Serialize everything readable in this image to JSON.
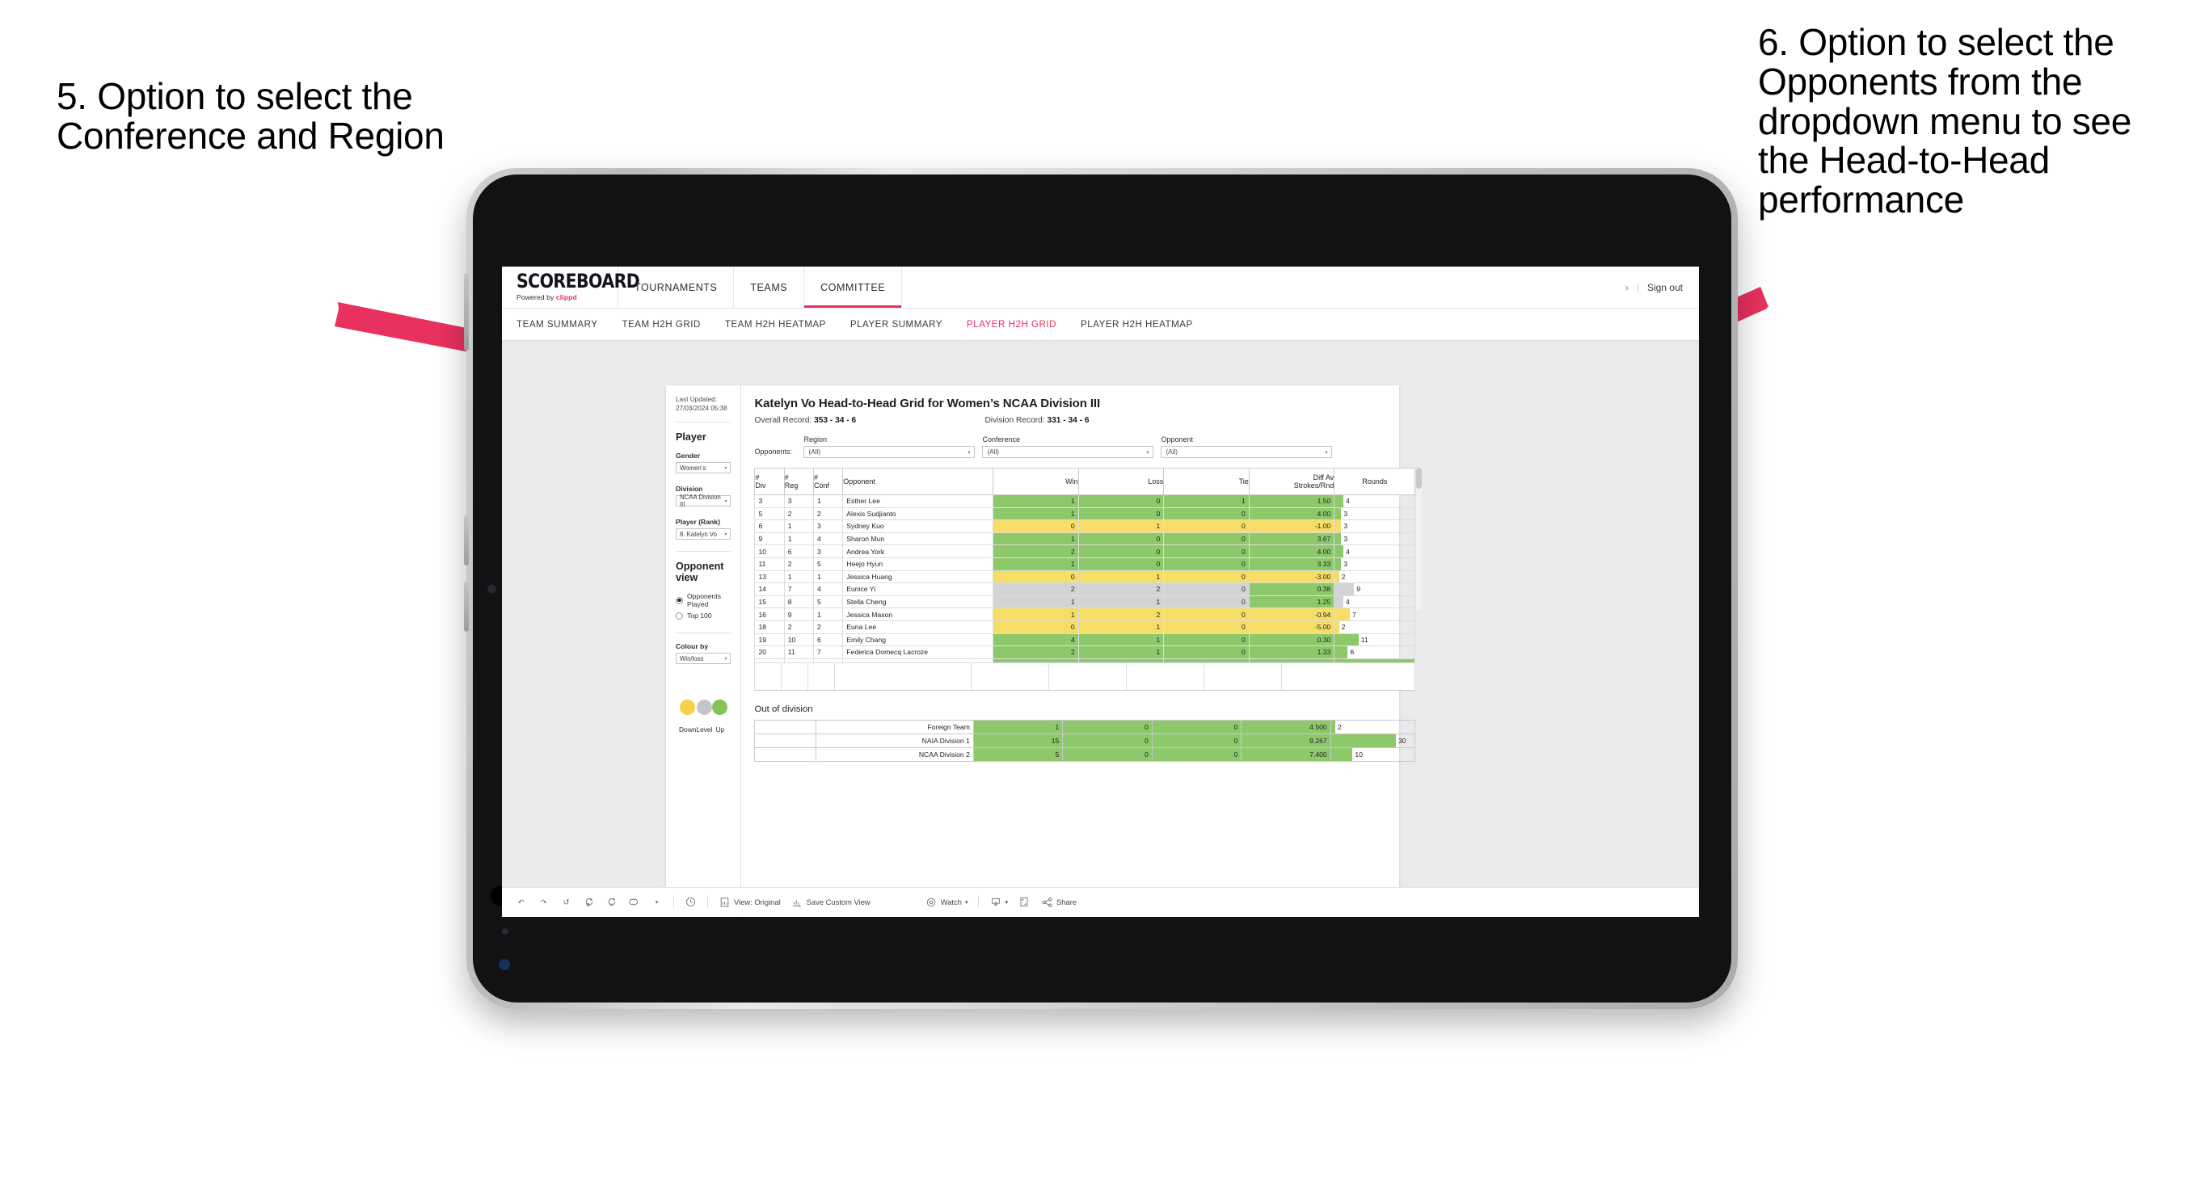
{
  "annotations": {
    "left": "5. Option to select the Conference and Region",
    "right": "6. Option to select the Opponents from the dropdown menu to see the Head-to-Head performance",
    "arrow_color": "#e8315f"
  },
  "appbar": {
    "brand_title": "SCOREBOARD",
    "brand_powered": "Powered by",
    "brand_name": "clippd",
    "nav": [
      {
        "label": "TOURNAMENTS",
        "active": false
      },
      {
        "label": "TEAMS",
        "active": false
      },
      {
        "label": "COMMITTEE",
        "active": true
      }
    ],
    "user_chevron": "›",
    "divider": "|",
    "sign_out": "Sign out"
  },
  "subnav": [
    {
      "label": "TEAM SUMMARY",
      "active": false
    },
    {
      "label": "TEAM H2H GRID",
      "active": false
    },
    {
      "label": "TEAM H2H HEATMAP",
      "active": false
    },
    {
      "label": "PLAYER SUMMARY",
      "active": false
    },
    {
      "label": "PLAYER H2H GRID",
      "active": true
    },
    {
      "label": "PLAYER H2H HEATMAP",
      "active": false
    }
  ],
  "rail": {
    "last_updated": "Last Updated: 27/03/2024 05:38",
    "player_heading": "Player",
    "gender_label": "Gender",
    "gender_value": "Women’s",
    "division_label": "Division",
    "division_value": "NCAA Division III",
    "player_rank_label": "Player (Rank)",
    "player_rank_value": "8. Katelyn Vo",
    "opponent_view_heading": "Opponent view",
    "opponent_view_options": [
      {
        "label": "Opponents Played",
        "selected": true
      },
      {
        "label": "Top 100",
        "selected": false
      }
    ],
    "colour_by_label": "Colour by",
    "colour_by_value": "Win/loss",
    "legend": [
      {
        "caption": "Down",
        "color": "#f3d14b"
      },
      {
        "caption": "Level",
        "color": "#c4c6c9"
      },
      {
        "caption": "Up",
        "color": "#83c359"
      }
    ],
    "caret": "▾"
  },
  "panel": {
    "title": "Katelyn Vo Head-to-Head Grid for Women’s NCAA Division III",
    "overall_label": "Overall Record:",
    "overall_value": "353 - 34 - 6",
    "division_label": "Division Record:",
    "division_value": "331 - 34 - 6",
    "opponents_label": "Opponents:",
    "filters": [
      {
        "label": "Region",
        "value": "(All)"
      },
      {
        "label": "Conference",
        "value": "(All)"
      },
      {
        "label": "Opponent",
        "value": "(All)"
      }
    ],
    "caret": "▾"
  },
  "chart_data": {
    "type": "table",
    "title": "Katelyn Vo Head-to-Head Grid for Women's NCAA Division III",
    "columns": [
      "# Div",
      "# Reg",
      "# Conf",
      "Opponent",
      "Win",
      "Loss",
      "Tie",
      "Diff Av Strokes/Rnd",
      "Rounds"
    ],
    "column_header_lines": [
      [
        "#",
        "Div"
      ],
      [
        "#",
        "Reg"
      ],
      [
        "#",
        "Conf"
      ],
      [
        "Opponent"
      ],
      [
        "Win"
      ],
      [
        "Loss"
      ],
      [
        "Tie"
      ],
      [
        "Diff Av",
        "Strokes/Rnd"
      ],
      [
        "Rounds"
      ]
    ],
    "colors": {
      "up": "#8dc96a",
      "down": "#f5dd66",
      "level": "#d2d3d4"
    },
    "rounds_max": 34,
    "rows": [
      {
        "div": "3",
        "reg": "3",
        "conf": "1",
        "opponent": "Esther Lee",
        "win": "1",
        "loss": "0",
        "tie": "1",
        "diff": "1.50",
        "rounds": "4",
        "rounds_n": 4,
        "state": "up"
      },
      {
        "div": "5",
        "reg": "2",
        "conf": "2",
        "opponent": "Alexis Sudjianto",
        "win": "1",
        "loss": "0",
        "tie": "0",
        "diff": "4.00",
        "rounds": "3",
        "rounds_n": 3,
        "state": "up"
      },
      {
        "div": "6",
        "reg": "1",
        "conf": "3",
        "opponent": "Sydney Kuo",
        "win": "0",
        "loss": "1",
        "tie": "0",
        "diff": "-1.00",
        "rounds": "3",
        "rounds_n": 3,
        "state": "down"
      },
      {
        "div": "9",
        "reg": "1",
        "conf": "4",
        "opponent": "Sharon Mun",
        "win": "1",
        "loss": "0",
        "tie": "0",
        "diff": "3.67",
        "rounds": "3",
        "rounds_n": 3,
        "state": "up"
      },
      {
        "div": "10",
        "reg": "6",
        "conf": "3",
        "opponent": "Andrea York",
        "win": "2",
        "loss": "0",
        "tie": "0",
        "diff": "4.00",
        "rounds": "4",
        "rounds_n": 4,
        "state": "up"
      },
      {
        "div": "11",
        "reg": "2",
        "conf": "5",
        "opponent": "Heejo Hyun",
        "win": "1",
        "loss": "0",
        "tie": "0",
        "diff": "3.33",
        "rounds": "3",
        "rounds_n": 3,
        "state": "up"
      },
      {
        "div": "13",
        "reg": "1",
        "conf": "1",
        "opponent": "Jessica Huang",
        "win": "0",
        "loss": "1",
        "tie": "0",
        "diff": "-3.00",
        "rounds": "2",
        "rounds_n": 2,
        "state": "down"
      },
      {
        "div": "14",
        "reg": "7",
        "conf": "4",
        "opponent": "Eunice Yi",
        "win": "2",
        "loss": "2",
        "tie": "0",
        "diff": "0.38",
        "rounds": "9",
        "rounds_n": 9,
        "state": "level",
        "diff_state": "up"
      },
      {
        "div": "15",
        "reg": "8",
        "conf": "5",
        "opponent": "Stella Cheng",
        "win": "1",
        "loss": "1",
        "tie": "0",
        "diff": "1.25",
        "rounds": "4",
        "rounds_n": 4,
        "state": "level",
        "diff_state": "up"
      },
      {
        "div": "16",
        "reg": "9",
        "conf": "1",
        "opponent": "Jessica Mason",
        "win": "1",
        "loss": "2",
        "tie": "0",
        "diff": "-0.94",
        "rounds": "7",
        "rounds_n": 7,
        "state": "down"
      },
      {
        "div": "18",
        "reg": "2",
        "conf": "2",
        "opponent": "Euna Lee",
        "win": "0",
        "loss": "1",
        "tie": "0",
        "diff": "-5.00",
        "rounds": "2",
        "rounds_n": 2,
        "state": "down"
      },
      {
        "div": "19",
        "reg": "10",
        "conf": "6",
        "opponent": "Emily Chang",
        "win": "4",
        "loss": "1",
        "tie": "0",
        "diff": "0.30",
        "rounds": "11",
        "rounds_n": 11,
        "state": "up"
      },
      {
        "div": "20",
        "reg": "11",
        "conf": "7",
        "opponent": "Federica Domecq Lacroze",
        "win": "2",
        "loss": "1",
        "tie": "0",
        "diff": "1.33",
        "rounds": "6",
        "rounds_n": 6,
        "state": "up"
      }
    ],
    "out_of_division": {
      "title": "Out of division",
      "rows": [
        {
          "name": "Foreign Team",
          "win": "1",
          "loss": "0",
          "tie": "0",
          "diff": "4.500",
          "rounds": "2",
          "rounds_n": 2,
          "state": "up"
        },
        {
          "name": "NAIA Division 1",
          "win": "15",
          "loss": "0",
          "tie": "0",
          "diff": "9.267",
          "rounds": "30",
          "rounds_n": 30,
          "state": "up"
        },
        {
          "name": "NCAA Division 2",
          "win": "5",
          "loss": "0",
          "tie": "0",
          "diff": "7.400",
          "rounds": "10",
          "rounds_n": 10,
          "state": "up"
        }
      ]
    }
  },
  "toolbar": {
    "undo": "↶",
    "redo": "↷",
    "revert": "↺",
    "refresh": "refresh-icon",
    "pause": "pause-icon",
    "highlight": "highlight-icon",
    "caret": "▾",
    "clock": "◔",
    "view_label": "View: Original",
    "save_label": "Save Custom View",
    "watch_label": "Watch",
    "download_icon": "download-icon",
    "fullscreen_icon": "fullscreen-icon",
    "share_label": "Share"
  }
}
